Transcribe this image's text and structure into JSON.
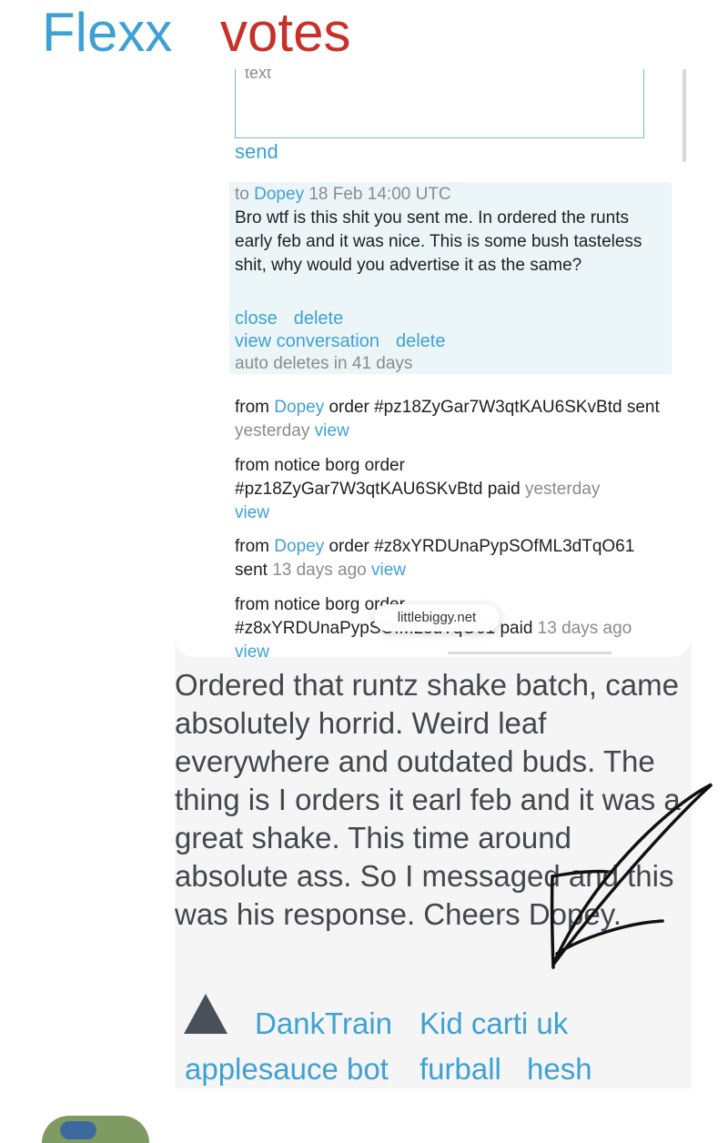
{
  "header": {
    "brand": "Flexx",
    "votes": "votes"
  },
  "compose": {
    "placeholder": "text",
    "send": "send"
  },
  "sent_message": {
    "to": "to",
    "recipient": "Dopey",
    "timestamp": "18 Feb 14:00 UTC",
    "body": "Bro wtf is this shit you sent me. In ordered the runts early feb and it was nice. This is some bush tasteless shit, why would you advertise it as the same?",
    "close": "close",
    "delete1": "delete",
    "view_conversation": "view conversation",
    "delete2": "delete",
    "auto_delete": "auto deletes in 41 days"
  },
  "notifications": [
    {
      "prefix": "from ",
      "sender": "Dopey",
      "text": " order #pz18ZyGar7W3qtKAU6SKvBtd sent",
      "time": "yesterday",
      "view": "view"
    },
    {
      "prefix": "from notice borg order",
      "text": "#pz18ZyGar7W3qtKAU6SKvBtd paid",
      "time": "yesterday",
      "view": "view"
    },
    {
      "prefix": "from ",
      "sender": "Dopey",
      "text": " order #z8xYRDUnaPypSOfML3dTqO61 sent",
      "time": "13 days ago",
      "view": "view"
    },
    {
      "prefix": "from notice borg order",
      "text": "#z8xYRDUnaPypSOfML3dTqO61 paid",
      "time": "13 days ago",
      "view": "view"
    }
  ],
  "url_pill": "littlebiggy.net",
  "post_body": "Ordered that runtz shake batch, came absolutely horrid. Weird leaf everywhere and outdated buds. The thing is I orders it earl feb and it was a great shake. This time around absolute ass. So I messaged and this was his response. Cheers Dopey.",
  "voters": [
    "DankTrain",
    "Kid carti uk",
    "applesauce bot",
    "furball",
    "hesh"
  ],
  "colors": {
    "link": "#3ea1d4",
    "votes": "#c8302a",
    "text": "#43474d"
  },
  "icons": {
    "upvote": "upvote-triangle-icon"
  }
}
